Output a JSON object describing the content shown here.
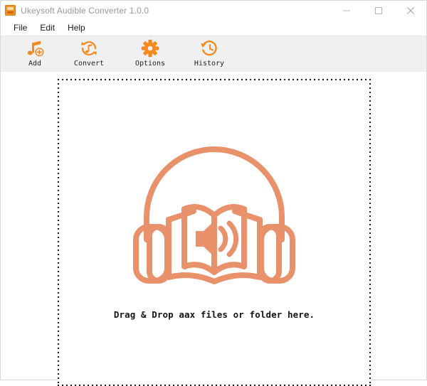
{
  "window": {
    "title": "Ukeysoft Audible Converter 1.0.0",
    "app_icon": "app-icon",
    "controls": {
      "minimize": "minimize-icon",
      "maximize": "maximize-icon",
      "close": "close-icon"
    }
  },
  "menu": {
    "items": [
      {
        "label": "File"
      },
      {
        "label": "Edit"
      },
      {
        "label": "Help"
      }
    ]
  },
  "toolbar": {
    "buttons": [
      {
        "label": "Add",
        "icon": "music-note-add-icon"
      },
      {
        "label": "Convert",
        "icon": "convert-refresh-icon"
      },
      {
        "label": "Options",
        "icon": "gear-icon"
      },
      {
        "label": "History",
        "icon": "clock-history-icon"
      }
    ]
  },
  "drop_zone": {
    "illustration": "headphones-audiobook-icon",
    "message": "Drag & Drop aax files or folder here."
  },
  "colors": {
    "accent_orange": "#F5881F",
    "illustration_salmon": "#E8916B",
    "toolbar_background": "#F0F0F0",
    "title_text": "#9A9A9A",
    "border_dot": "#1A1A1A"
  }
}
